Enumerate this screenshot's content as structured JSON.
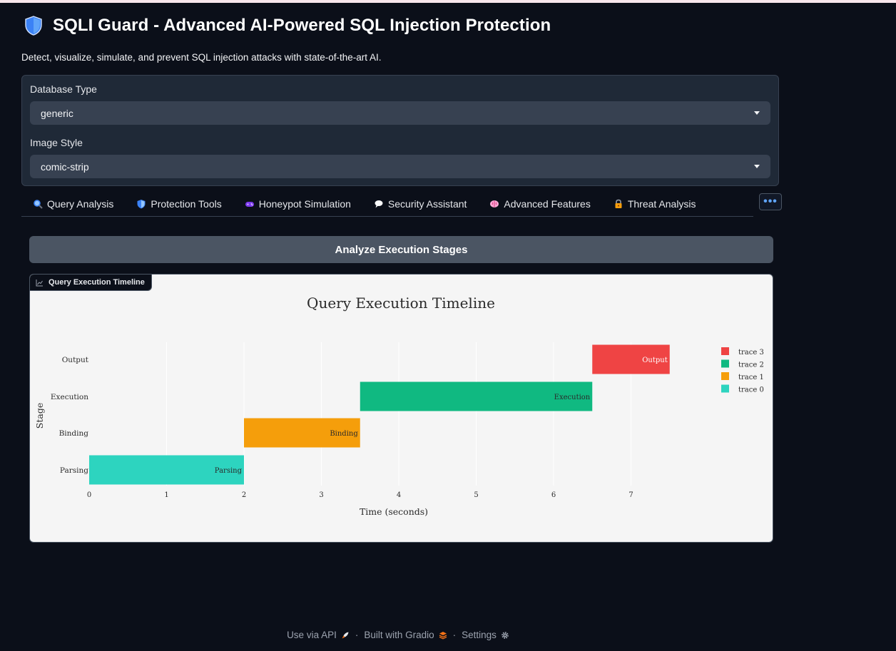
{
  "header": {
    "title": "SQLI Guard - Advanced AI-Powered SQL Injection Protection",
    "subtitle": "Detect, visualize, simulate, and prevent SQL injection attacks with state-of-the-art AI."
  },
  "settings": {
    "database_type": {
      "label": "Database Type",
      "value": "generic"
    },
    "image_style": {
      "label": "Image Style",
      "value": "comic-strip"
    }
  },
  "tabs": [
    {
      "label": "Query Analysis",
      "icon": "magnifier-icon"
    },
    {
      "label": "Protection Tools",
      "icon": "shield-icon"
    },
    {
      "label": "Honeypot Simulation",
      "icon": "gamepad-icon"
    },
    {
      "label": "Security Assistant",
      "icon": "speech-bubble-icon"
    },
    {
      "label": "Advanced Features",
      "icon": "brain-icon"
    },
    {
      "label": "Threat Analysis",
      "icon": "lock-icon"
    }
  ],
  "more_button": "•••",
  "analyze_button": "Analyze Execution Stages",
  "plot_label": "Query Execution Timeline",
  "footer": {
    "api": "Use via API",
    "gradio": "Built with Gradio",
    "settings": "Settings",
    "separator": "·"
  },
  "colors": {
    "parsing": "#2dd4bf",
    "binding": "#f59e0b",
    "execution": "#10b981",
    "output": "#ef4444"
  },
  "chart_data": {
    "type": "bar",
    "orientation": "horizontal",
    "title": "Query Execution Timeline",
    "xlabel": "Time (seconds)",
    "ylabel": "Stage",
    "xlim": [
      0,
      8
    ],
    "xticks": [
      0,
      1,
      2,
      3,
      4,
      5,
      6,
      7
    ],
    "categories": [
      "Parsing",
      "Binding",
      "Execution",
      "Output"
    ],
    "series": [
      {
        "name": "trace 0",
        "category": "Parsing",
        "start": 0,
        "end": 2,
        "label": "Parsing",
        "color": "#2dd4bf"
      },
      {
        "name": "trace 1",
        "category": "Binding",
        "start": 2,
        "end": 3.5,
        "label": "Binding",
        "color": "#f59e0b"
      },
      {
        "name": "trace 2",
        "category": "Execution",
        "start": 3.5,
        "end": 6.5,
        "label": "Execution",
        "color": "#10b981"
      },
      {
        "name": "trace 3",
        "category": "Output",
        "start": 6.5,
        "end": 7.5,
        "label": "Output",
        "color": "#ef4444"
      }
    ],
    "legend_position": "top-right",
    "legend_order": [
      "trace 3",
      "trace 2",
      "trace 1",
      "trace 0"
    ],
    "grid": "vertical"
  }
}
